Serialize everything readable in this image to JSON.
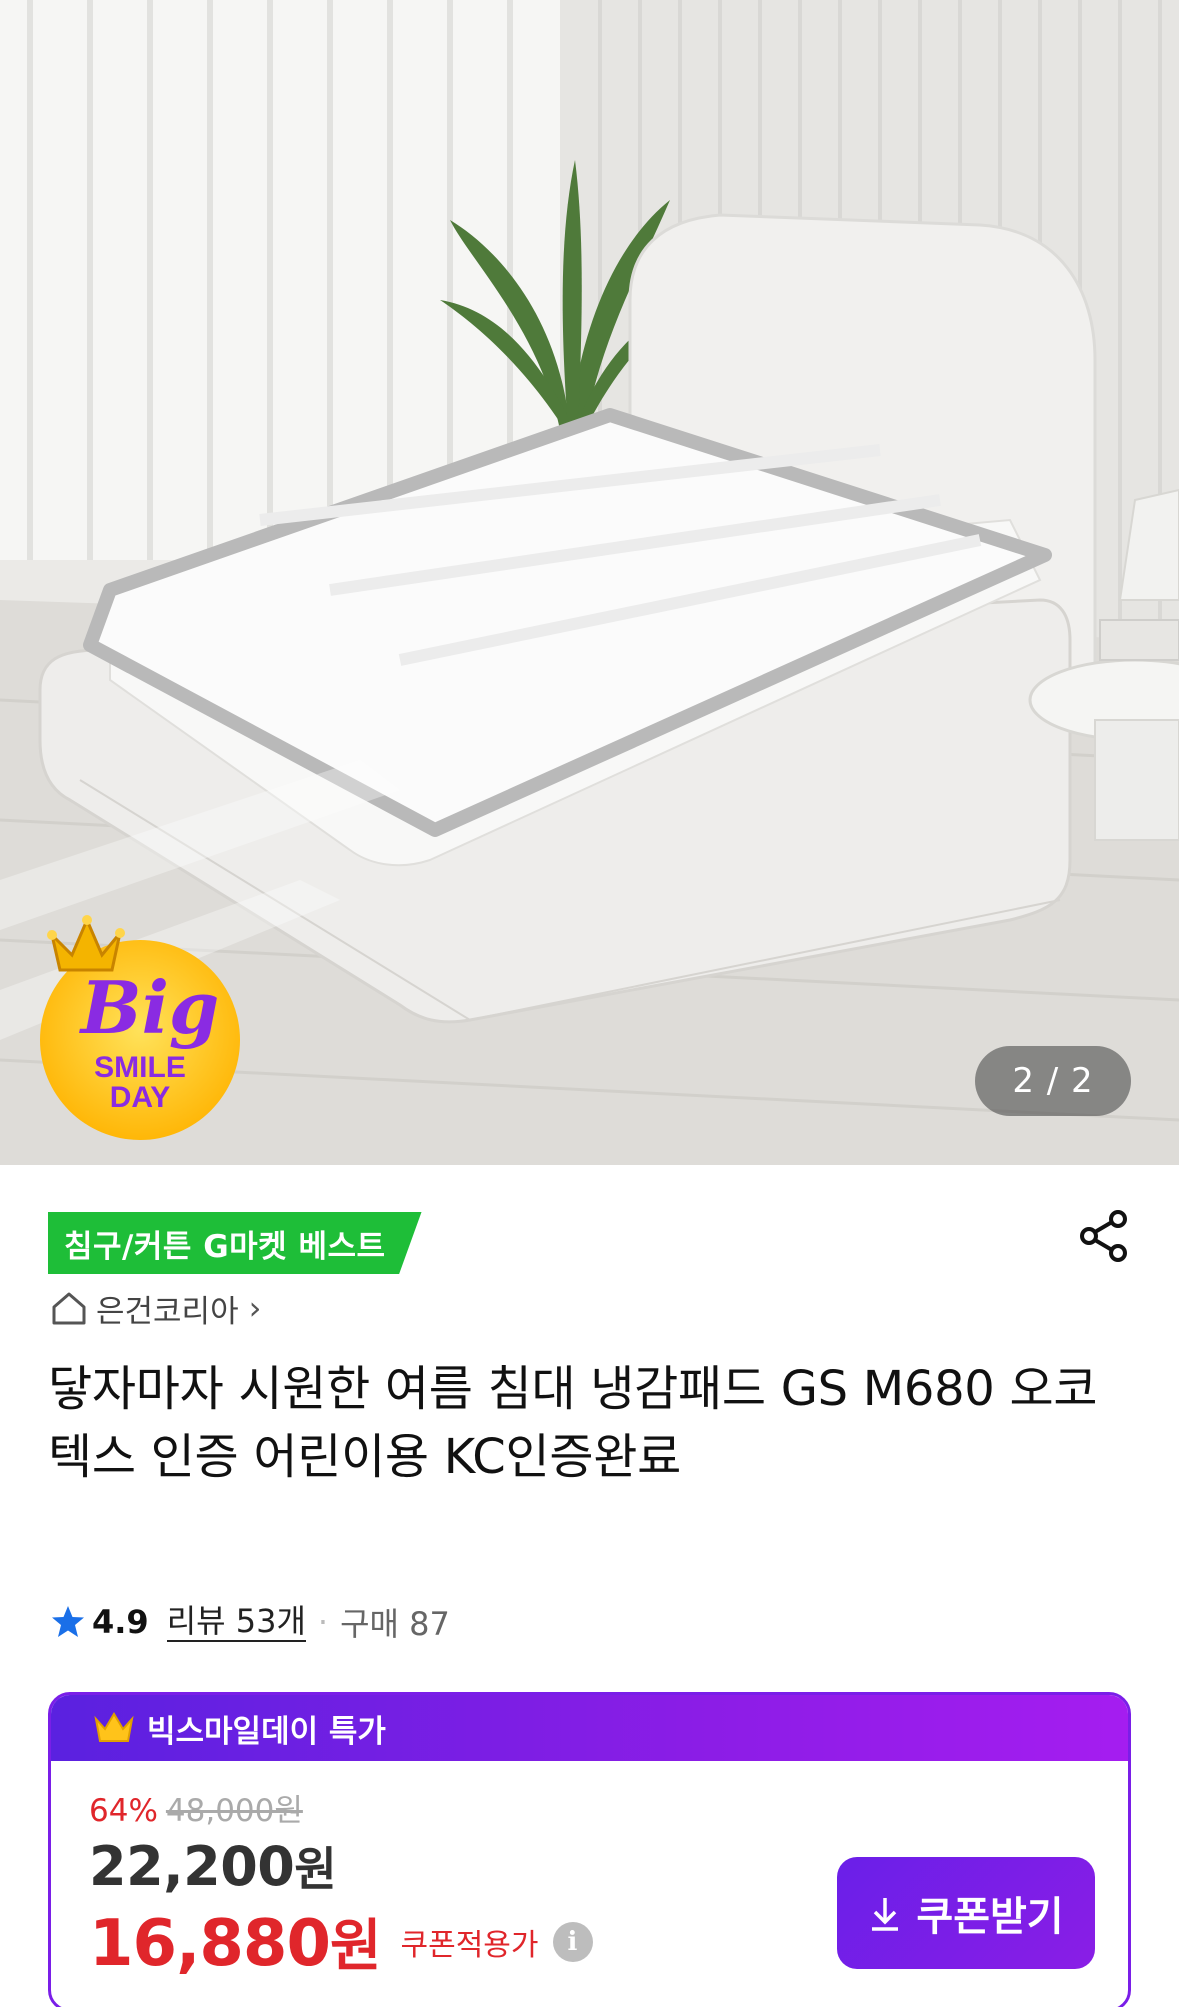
{
  "gallery": {
    "counter": "2 / 2"
  },
  "badge": {
    "big": "Big",
    "smile": "SMILE",
    "day": "DAY"
  },
  "category_badge": "침구/커튼 G마켓 베스트",
  "seller": {
    "name": "은건코리아",
    "chevron": "›"
  },
  "product_title": "닿자마자 시원한 여름 침대 냉감패드 GS M680 오코텍스 인증 어린이용 KC인증완료",
  "rating": {
    "score": "4.9",
    "review_label": "리뷰 53개",
    "separator": "·",
    "purchase": "구매 87"
  },
  "deal": {
    "header": "빅스마일데이 특가",
    "discount_pct": "64%",
    "original_price": "48,000원",
    "price": "22,200",
    "price_unit": "원",
    "coupon_price": "16,880",
    "coupon_price_unit": "원",
    "coupon_note": "쿠폰적용가",
    "info_glyph": "i",
    "coupon_button": "쿠폰받기"
  },
  "icons": [
    "share-icon",
    "home-icon",
    "star-icon",
    "crown-icon",
    "download-icon",
    "info-icon"
  ],
  "colors": {
    "accent_purple": "#7a1ee8",
    "sale_red": "#e0262b",
    "category_green": "#1ebe38",
    "star_blue": "#1a6fe8"
  }
}
